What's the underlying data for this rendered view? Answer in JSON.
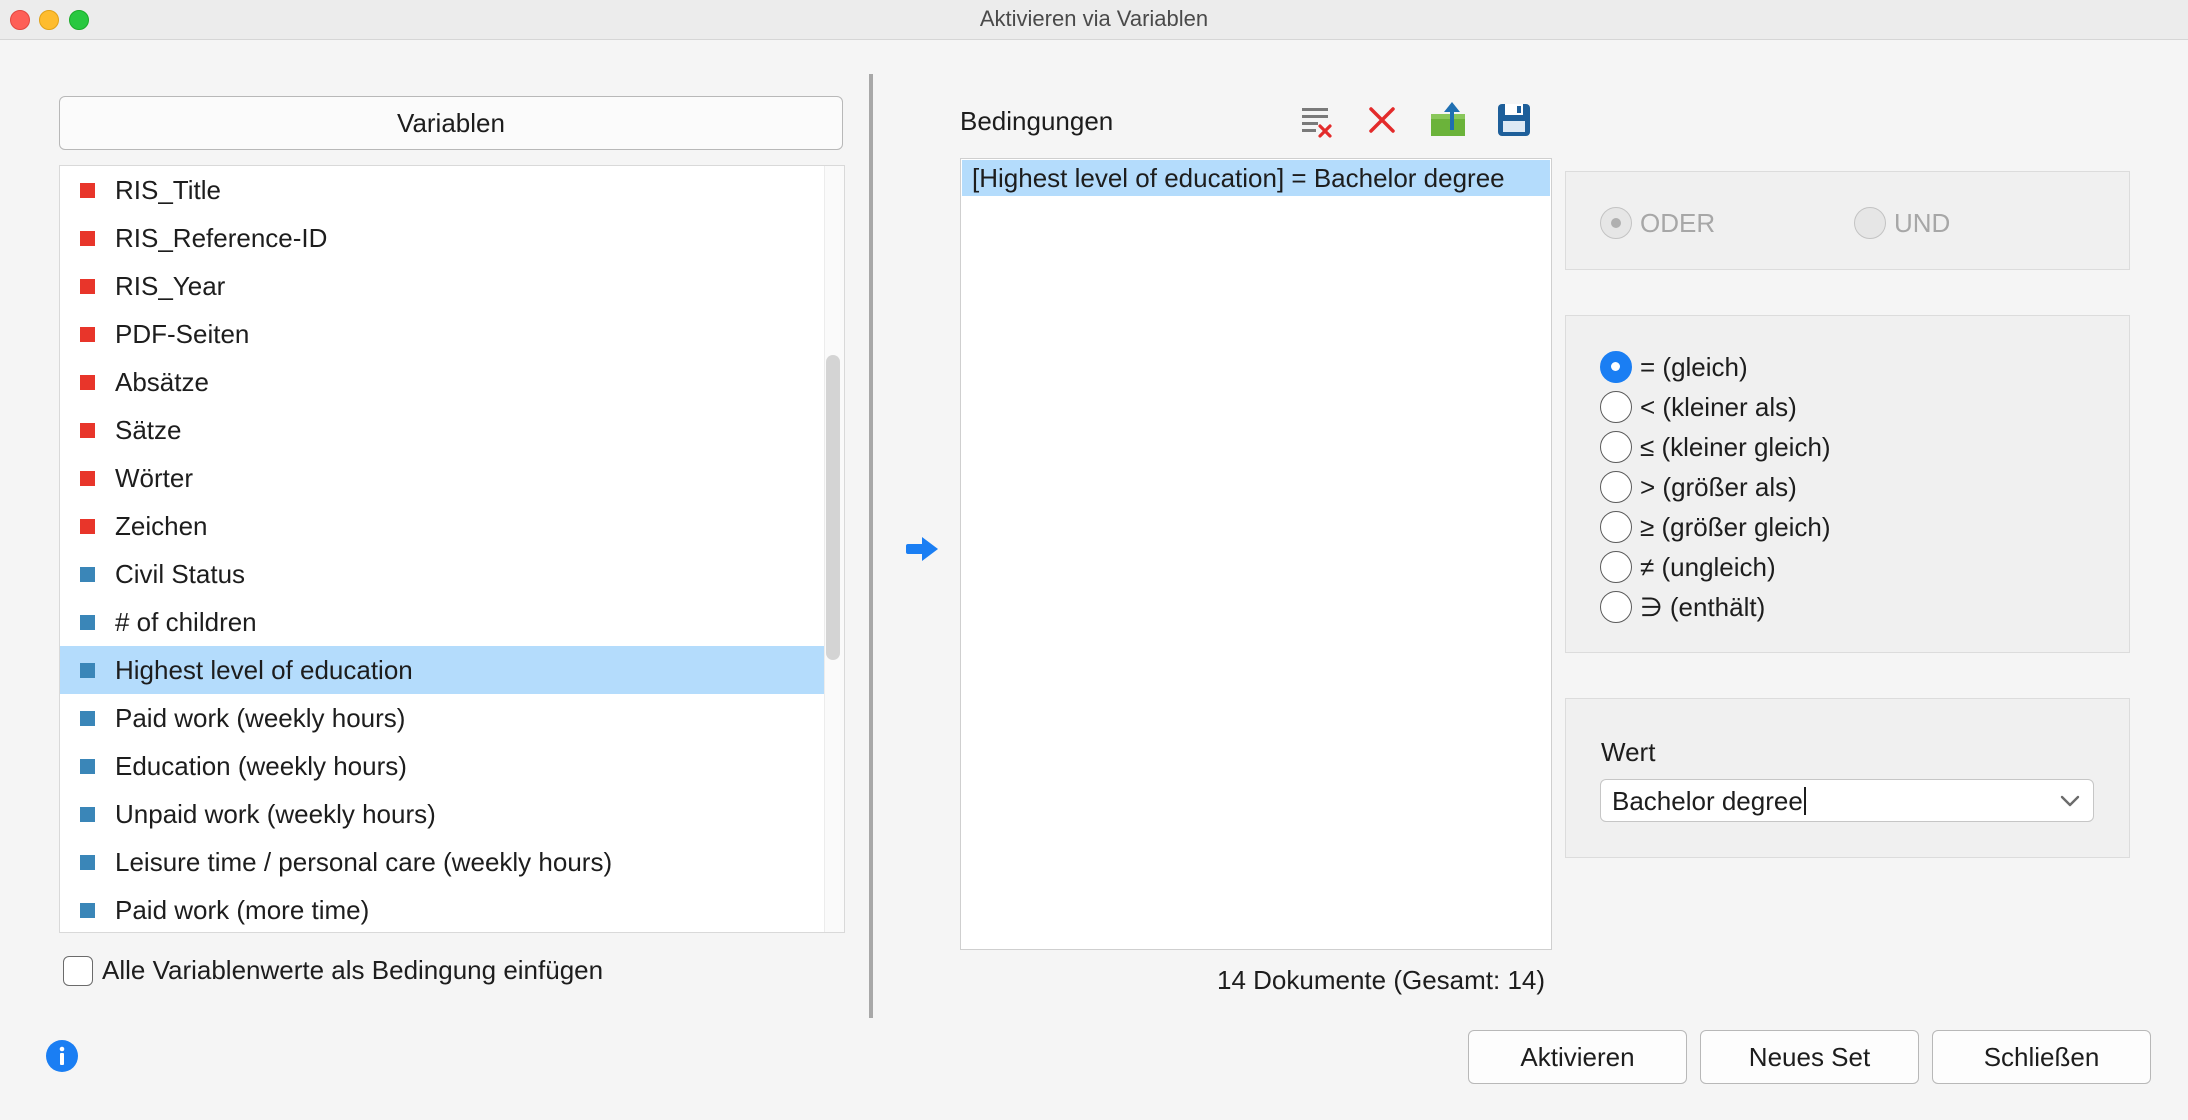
{
  "window": {
    "title": "Aktivieren via Variablen"
  },
  "variables": {
    "header": "Variablen",
    "items": [
      {
        "label": "RIS_Title",
        "color": "#e8352a"
      },
      {
        "label": "RIS_Reference-ID",
        "color": "#e8352a"
      },
      {
        "label": "RIS_Year",
        "color": "#e8352a"
      },
      {
        "label": "PDF-Seiten",
        "color": "#e8352a"
      },
      {
        "label": "Absätze",
        "color": "#e8352a"
      },
      {
        "label": "Sätze",
        "color": "#e8352a"
      },
      {
        "label": "Wörter",
        "color": "#e8352a"
      },
      {
        "label": "Zeichen",
        "color": "#e8352a"
      },
      {
        "label": "Civil Status",
        "color": "#3a86b8"
      },
      {
        "label": "# of children",
        "color": "#3a86b8"
      },
      {
        "label": "Highest level of education",
        "color": "#3a86b8",
        "selected": true
      },
      {
        "label": "Paid work (weekly hours)",
        "color": "#3a86b8"
      },
      {
        "label": "Education (weekly hours)",
        "color": "#3a86b8"
      },
      {
        "label": "Unpaid work (weekly hours)",
        "color": "#3a86b8"
      },
      {
        "label": "Leisure time / personal care (weekly hours)",
        "color": "#3a86b8"
      },
      {
        "label": "Paid work (more time)",
        "color": "#3a86b8"
      }
    ],
    "insert_all_label": "Alle Variablenwerte als Bedingung einfügen"
  },
  "conditions": {
    "label": "Bedingungen",
    "items": [
      "[Highest level of education] = Bachelor degree"
    ],
    "doc_count": "14 Dokumente (Gesamt: 14)",
    "toolbar_icons": [
      "clear-list-icon",
      "delete-icon",
      "export-icon",
      "save-icon"
    ]
  },
  "logic": {
    "or_label": "ODER",
    "and_label": "UND",
    "selected": "ODER"
  },
  "operators": {
    "options": [
      "= (gleich)",
      "< (kleiner als)",
      "≤ (kleiner gleich)",
      "> (größer als)",
      "≥ (größer gleich)",
      "≠ (ungleich)",
      "∋ (enthält)"
    ],
    "selected": "= (gleich)"
  },
  "wert": {
    "label": "Wert",
    "value": "Bachelor degree"
  },
  "buttons": {
    "activate": "Aktivieren",
    "new_set": "Neues Set",
    "close": "Schließen"
  },
  "colors": {
    "accent": "#1a7ef3",
    "selection": "#b4dcfc"
  }
}
